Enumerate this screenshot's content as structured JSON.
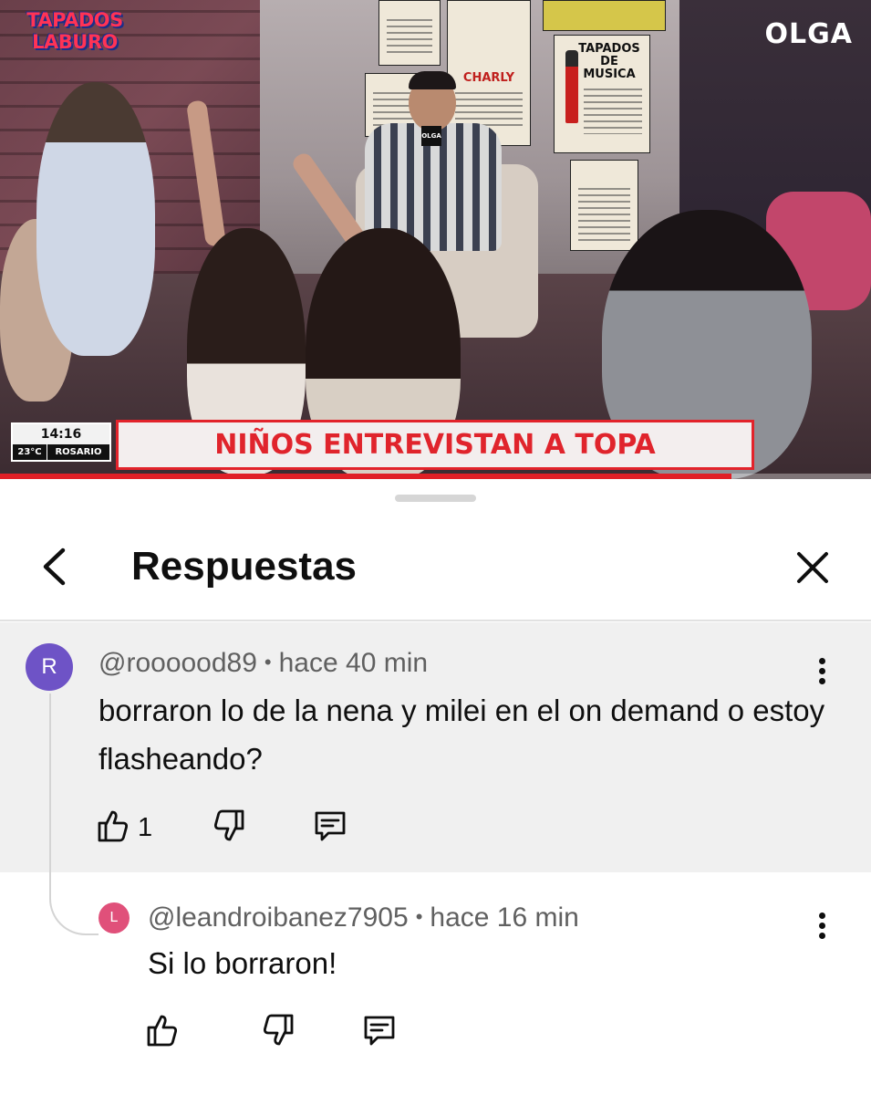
{
  "video": {
    "show_logo_line1": "TAPADOS",
    "show_logo_line2": "LABURO",
    "channel_logo": "OLGA",
    "clock_time": "14:16",
    "temperature": "23°C",
    "city": "ROSARIO",
    "headline": "NIÑOS ENTREVISTAN A TOPA",
    "poster_title_1": "TAPADOS DE MUSICA",
    "poster_title_2": "CHARLY",
    "mic_label": "OLGA",
    "progress": 0.84,
    "accent_color": "#e01f26"
  },
  "sheet": {
    "title": "Respuestas",
    "back_icon": "chevron-left-icon",
    "close_icon": "close-icon"
  },
  "comment": {
    "avatar_letter": "R",
    "avatar_color": "#6e53c6",
    "author": "@roooood89",
    "time": "hace 40 min",
    "text": "borraron lo de la nena y milei en el on demand o estoy flasheando?",
    "likes": "1"
  },
  "reply": {
    "avatar_letter": "L",
    "avatar_color": "#e0507a",
    "author": "@leandroibanez7905",
    "time": "hace 16 min",
    "text": "Si lo borraron!"
  }
}
